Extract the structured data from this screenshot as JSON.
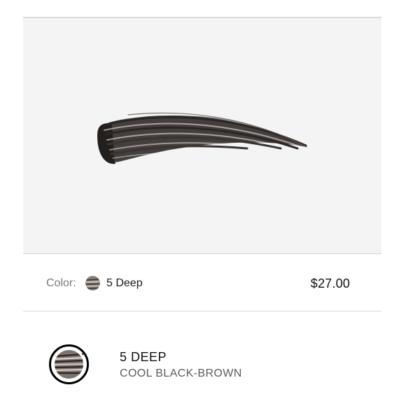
{
  "product": {
    "image": "eyebrow-pencil-stroke-swatch",
    "color_label": "Color:",
    "selected_color": "5 Deep",
    "price": "$27.00"
  },
  "shade": {
    "title": "5 DEEP",
    "description": "COOL BLACK-BROWN"
  },
  "colors": {
    "panel_bg": "#f4f4f4",
    "stroke_dark": "#2b2624",
    "stroke_mid": "#5e5753",
    "ring": "#000000"
  }
}
